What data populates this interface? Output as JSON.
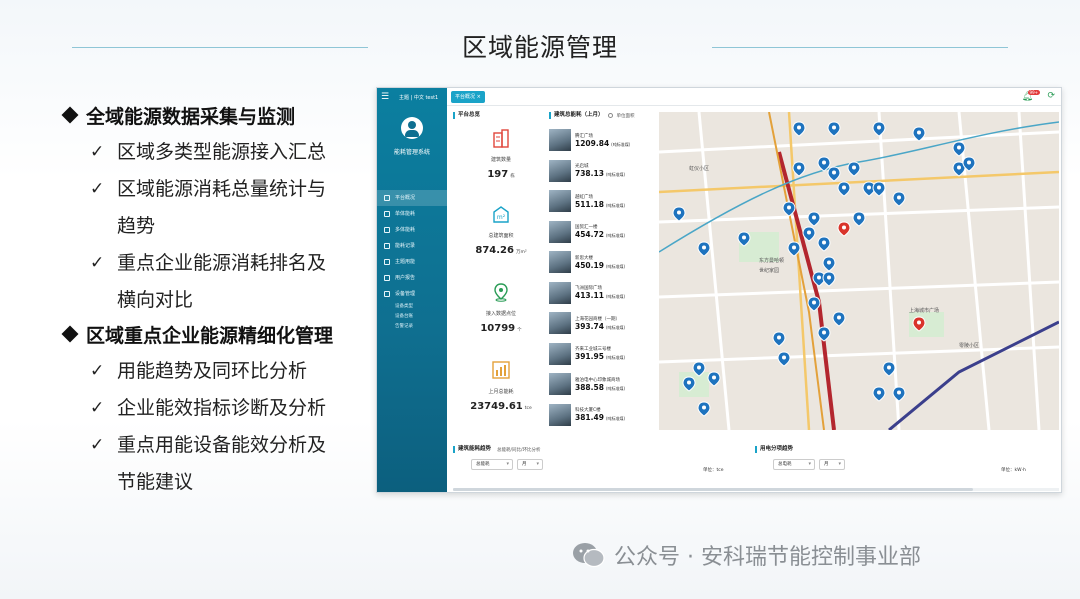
{
  "slide": {
    "title": "区域能源管理",
    "bullets": [
      {
        "text": "全域能源数据采集与监测",
        "subs": [
          "区域多类型能源接入汇总",
          "区域能源消耗总量统计与",
          "趋势",
          "重点企业能源消耗排名及",
          "横向对比"
        ]
      },
      {
        "text": "区域重点企业能源精细化管理",
        "subs": [
          "用能趋势及同环比分析",
          "企业能效指标诊断及分析",
          "重点用能设备能效分析及",
          "节能建议"
        ]
      }
    ],
    "check": "✓"
  },
  "app": {
    "top_text": "主题 | 中文   test1",
    "system_name": "能耗管理系统",
    "nav": [
      {
        "label": "平台概况",
        "active": true
      },
      {
        "label": "单体能耗"
      },
      {
        "label": "多体能耗"
      },
      {
        "label": "能耗记录"
      },
      {
        "label": "主题用能"
      },
      {
        "label": "用户报告"
      },
      {
        "label": "设备管理"
      }
    ],
    "nav_sub": [
      "设备类型",
      "设备台账",
      "告警记录"
    ],
    "tab": "平台概况 ×",
    "bell_badge": "99+",
    "overview": {
      "title": "平台总览",
      "items": [
        {
          "label": "建筑数量",
          "value": "197",
          "unit": "栋"
        },
        {
          "label": "总建筑面积",
          "value": "874.26",
          "unit": "万m²"
        },
        {
          "label": "接入数据点位",
          "value": "10799",
          "unit": "个"
        },
        {
          "label": "上月总能耗",
          "value": "23749.61",
          "unit": "tce"
        }
      ]
    },
    "ranking": {
      "title": "建筑总能耗（上月）",
      "toggle_label": "单位面积",
      "value_unit": "(吨标准煤)",
      "rows": [
        {
          "name": "腾汇广场",
          "value": "1209.84"
        },
        {
          "name": "光启城",
          "value": "738.13"
        },
        {
          "name": "越虹广场",
          "value": "511.18"
        },
        {
          "name": "国贸汇一楼",
          "value": "454.72"
        },
        {
          "name": "新思大楼",
          "value": "450.19"
        },
        {
          "name": "飞洲国际广场",
          "value": "413.11"
        },
        {
          "name": "上海花园商楼（一期）",
          "value": "393.74"
        },
        {
          "name": "齐来工业城三号楼",
          "value": "391.95"
        },
        {
          "name": "雅泊电中心印象城商场",
          "value": "388.58"
        },
        {
          "name": "科技大厦C楼",
          "value": "381.49"
        }
      ]
    },
    "trend_left": {
      "title": "建筑能耗趋势",
      "subtitle": "总能耗/同比/环比分析",
      "select1": "总能耗",
      "select2": "月",
      "unit": "单位：tce"
    },
    "trend_right": {
      "title": "用电分项趋势",
      "select1": "总电耗",
      "select2": "月",
      "unit": "单位：kW·h"
    },
    "map_labels": [
      "东方曼哈顿",
      "世纪家园",
      "虹仪小区",
      "零陵小区",
      "上海城市广场"
    ]
  },
  "watermark": "公众号 · 安科瑞节能控制事业部",
  "colors": {
    "sidebar": "#0f6f90",
    "accent": "#1aa3c8",
    "pin_blue": "#1e73be",
    "pin_red": "#d9342b",
    "metro_red": "#b3262e",
    "metro_orange": "#e3a13a"
  }
}
